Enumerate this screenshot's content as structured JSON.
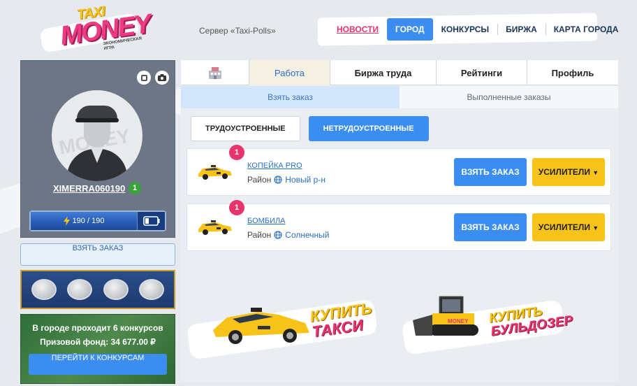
{
  "header": {
    "logo_top": "TAXI",
    "logo_main": "MONEY",
    "logo_sub": "ЭКОНОМИЧЕСКАЯ ИГРА",
    "server": "Сервер «Taxi-Polls»",
    "nav": [
      {
        "label": "НОВОСТИ",
        "state": "news"
      },
      {
        "label": "ГОРОД",
        "state": "active"
      },
      {
        "label": "КОНКУРСЫ",
        "state": ""
      },
      {
        "label": "БИРЖА",
        "state": ""
      },
      {
        "label": "КАРТА ГОРОДА",
        "state": ""
      }
    ]
  },
  "profile": {
    "avatar_watermark": "MONEY",
    "username": "XIMERRA060190",
    "level": "1",
    "energy": "190 / 190",
    "take_order": "ВЗЯТЬ ЗАКАЗ"
  },
  "contests": {
    "line1": "В городе проходит 6 конкурсов",
    "line2": "Призовой фонд: 34 677.00 ₽",
    "button": "ПЕРЕЙТИ К КОНКУРСАМ"
  },
  "tabs": [
    {
      "label": "",
      "icon": "building-icon"
    },
    {
      "label": "Работа",
      "active": true
    },
    {
      "label": "Биржа труда"
    },
    {
      "label": "Рейтинги"
    },
    {
      "label": "Профиль"
    }
  ],
  "subtabs": [
    "Взять заказ",
    "Выполненные заказы"
  ],
  "filters": [
    "ТРУДОУСТРОЕННЫЕ",
    "НЕТРУДОУСТРОЕННЫЕ"
  ],
  "orders": [
    {
      "num": "1",
      "name": "КОПЕЙКА PRO",
      "district_label": "Район",
      "district": "Новый р-н",
      "take": "ВЗЯТЬ ЗАКАЗ",
      "boost": "УСИЛИТЕЛИ"
    },
    {
      "num": "1",
      "name": "БОМБИЛА",
      "district_label": "Район",
      "district": "Солнечный",
      "take": "ВЗЯТЬ ЗАКАЗ",
      "boost": "УСИЛИТЕЛИ"
    }
  ],
  "promos": {
    "taxi_line1": "КУПИТЬ",
    "taxi_line2": "ТАКСИ",
    "bulldozer_line1": "КУПИТЬ",
    "bulldozer_line2": "БУЛЬДОЗЕР",
    "bulldozer_logo": "MONEY"
  },
  "colors": {
    "accent": "#3b8ef0",
    "pink": "#e8336c",
    "yellow": "#f7c31b",
    "green": "#39a33b"
  }
}
